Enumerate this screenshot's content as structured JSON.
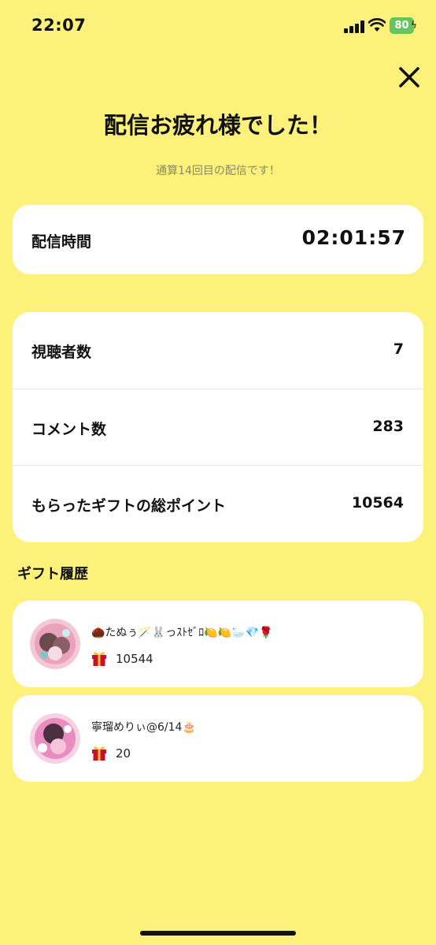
{
  "status_bar": {
    "time": "22:07",
    "battery": "80"
  },
  "header": {
    "close_icon": "close-icon",
    "title": "配信お疲れ様でした！",
    "subtitle": "通算14回目の配信です！"
  },
  "duration": {
    "label": "配信時間",
    "value": "02:01:57"
  },
  "stats": [
    {
      "label": "視聴者数",
      "value": "7"
    },
    {
      "label": "コメント数",
      "value": "283"
    },
    {
      "label": "もらったギフトの総ポイント",
      "value": "10564"
    }
  ],
  "gift_history": {
    "title": "ギフト履歴",
    "items": [
      {
        "name": "🌰たぬぅ🪄🐰っｽﾄｾﾞﾛ🍋🍋🦢💎🌹",
        "amount": "10544"
      },
      {
        "name": "寧瑠めりぃ@6/14🎂",
        "amount": "20"
      }
    ]
  },
  "colors": {
    "background": "#fcf27b",
    "card": "#ffffff",
    "battery": "#66c35f",
    "gift_icon": "#c8102e"
  }
}
